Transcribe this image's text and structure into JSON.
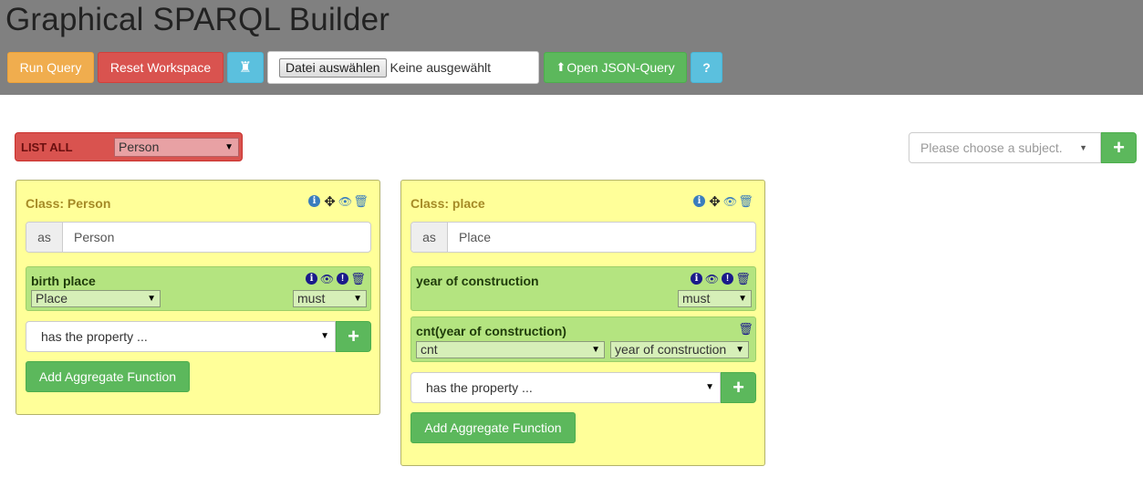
{
  "header": {
    "title": "Graphical SPARQL Builder",
    "run_label": "Run Query",
    "reset_label": "Reset Workspace",
    "rook_glyph": "♜",
    "file_button_label": "Datei auswählen",
    "file_status": "Keine ausgewählt",
    "open_label": "Open JSON-Query",
    "open_glyph": "⬆",
    "help_label": "?"
  },
  "listall": {
    "label": "LIST ALL",
    "selected": "Person"
  },
  "subject": {
    "placeholder": "Please choose a subject.",
    "add_glyph": "+"
  },
  "cards": [
    {
      "title": "Class: Person",
      "as_label": "as",
      "alias": "Person",
      "properties": [
        {
          "title": "birth place",
          "target_select": "Place",
          "mode_select": "must"
        }
      ],
      "has_property_placeholder": "has the property ...",
      "aggregate_label": "Add Aggregate Function"
    },
    {
      "title": "Class: place",
      "as_label": "as",
      "alias": "Place",
      "properties": [
        {
          "title": "year of construction",
          "mode_select": "must"
        }
      ],
      "aggregates": [
        {
          "title": "cnt(year of construction)",
          "function_select": "cnt",
          "field_select": "year of construction"
        }
      ],
      "has_property_placeholder": "has the property ...",
      "aggregate_label": "Add Aggregate Function"
    }
  ],
  "icons": {
    "info": "i",
    "move": "✥",
    "eye": "👁",
    "trash": "🗑",
    "exclamation": "!",
    "caret": "▼",
    "plus": "+"
  },
  "colors": {
    "header_bg": "#808080",
    "run": "#f0ad4e",
    "reset": "#d9534f",
    "info": "#5bc0de",
    "success": "#5cb85c",
    "card_bg": "#ffff99",
    "property_bg": "#b4e480"
  }
}
